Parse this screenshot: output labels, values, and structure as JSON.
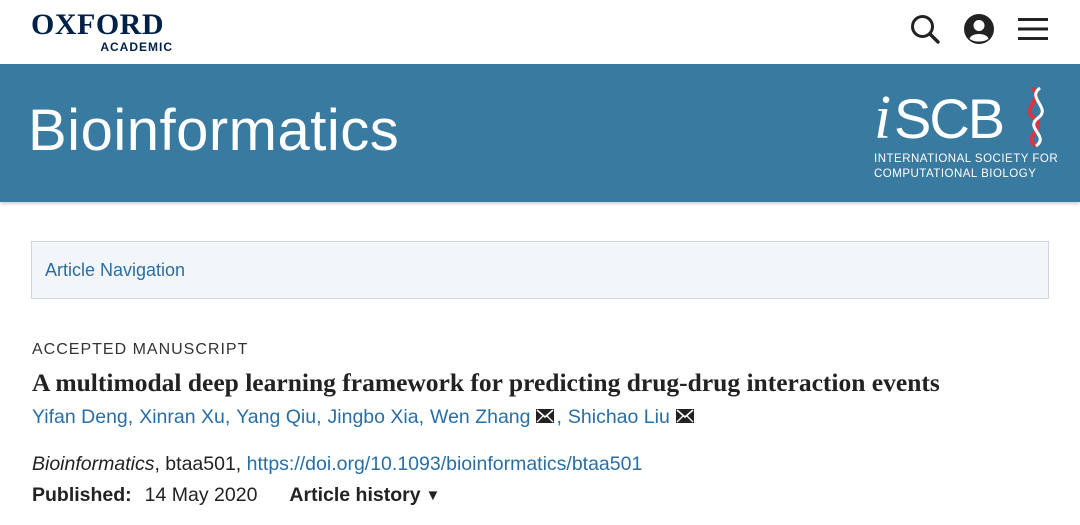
{
  "header": {
    "brand_main": "OXFORD",
    "brand_sub": "ACADEMIC",
    "icons": [
      "search-icon",
      "user-account-icon",
      "menu-icon"
    ]
  },
  "banner": {
    "journal_title": "Bioinformatics",
    "society_logo_text": "iSCB",
    "society_line1": "INTERNATIONAL SOCIETY FOR",
    "society_line2": "COMPUTATIONAL BIOLOGY",
    "background_color": "#387aa0"
  },
  "article_navigation": {
    "label": "Article Navigation"
  },
  "article": {
    "status": "ACCEPTED MANUSCRIPT",
    "title": "A multimodal deep learning framework for predicting drug-drug interaction events",
    "authors": [
      {
        "name": "Yifan Deng",
        "corresponding": false
      },
      {
        "name": "Xinran Xu",
        "corresponding": false
      },
      {
        "name": "Yang Qiu",
        "corresponding": false
      },
      {
        "name": "Jingbo Xia",
        "corresponding": false
      },
      {
        "name": "Wen Zhang",
        "corresponding": true
      },
      {
        "name": "Shichao Liu",
        "corresponding": true
      }
    ],
    "journal": "Bioinformatics",
    "article_id": ", btaa501, ",
    "doi": "https://doi.org/10.1093/bioinformatics/btaa501",
    "published_label": "Published:",
    "published_date": "14 May 2020",
    "history_label": "Article history"
  },
  "colors": {
    "link": "#2a6ea4",
    "brand_navy": "#002147"
  }
}
